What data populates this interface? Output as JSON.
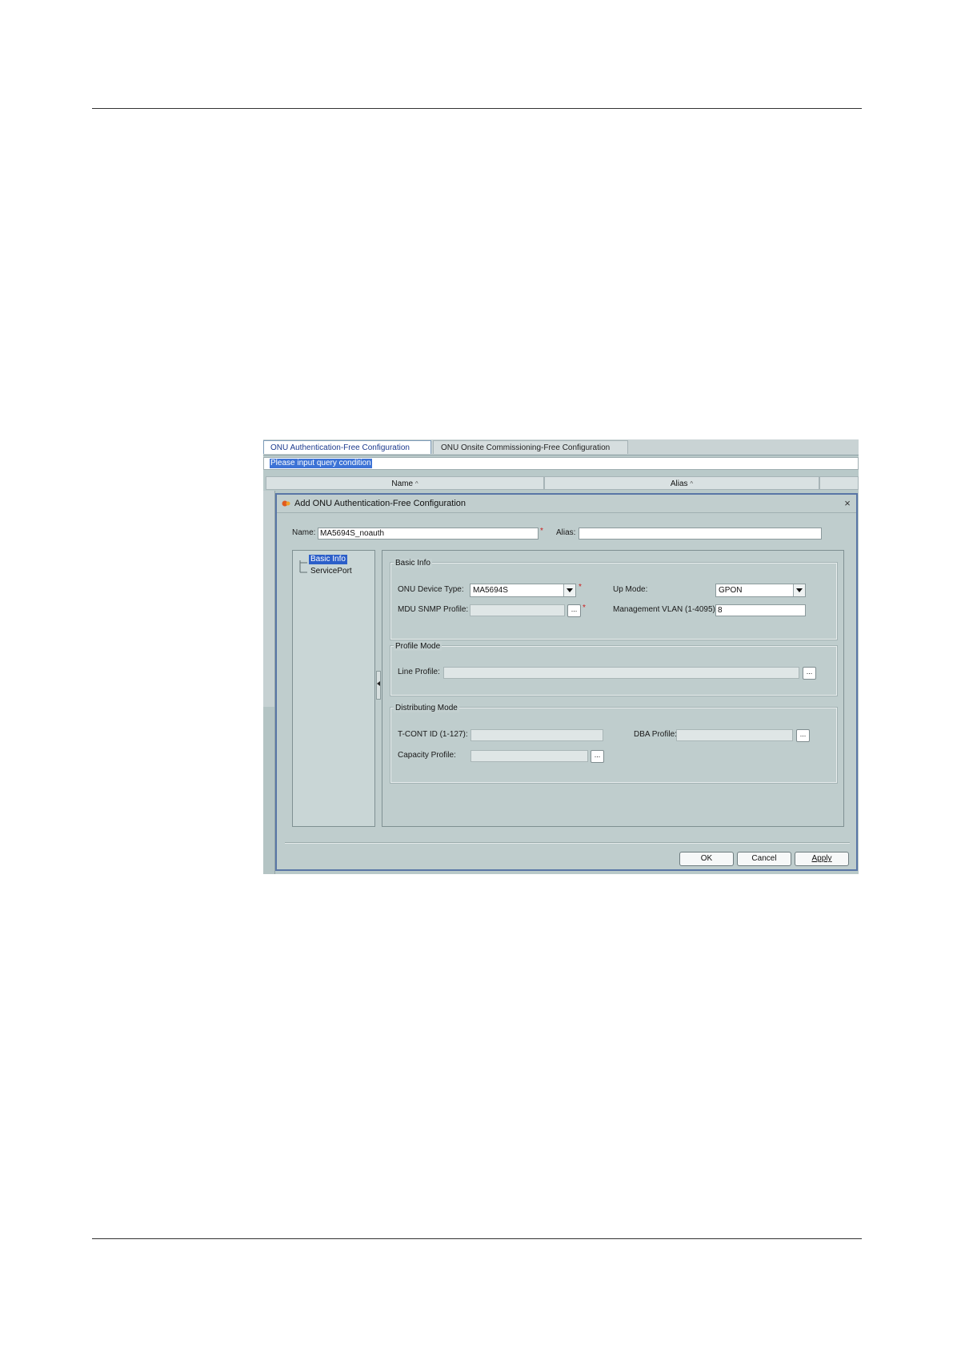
{
  "tabs": [
    {
      "label": "ONU Authentication-Free Configuration"
    },
    {
      "label": "ONU Onsite Commissioning-Free Configuration"
    }
  ],
  "query": {
    "placeholder": "Please input query condition"
  },
  "table": {
    "columns": [
      "Name",
      "Alias"
    ],
    "sort_glyph": "^"
  },
  "dialog": {
    "title": "Add ONU Authentication-Free Configuration",
    "close_glyph": "×",
    "name_label": "Name:",
    "name_value": "MA5694S_noauth",
    "alias_label": "Alias:",
    "alias_value": "",
    "required_mark": "*",
    "tree": [
      "Basic Info",
      "ServicePort"
    ],
    "basic_info": {
      "title": "Basic Info",
      "onu_device_type_label": "ONU Device Type:",
      "onu_device_type_value": "MA5694S",
      "up_mode_label": "Up Mode:",
      "up_mode_value": "GPON",
      "mdu_snmp_profile_label": "MDU SNMP Profile:",
      "mdu_snmp_profile_value": "",
      "mgmt_vlan_label": "Management VLAN (1-4095):",
      "mgmt_vlan_value": "8"
    },
    "profile_mode": {
      "title": "Profile Mode",
      "line_profile_label": "Line Profile:",
      "line_profile_value": ""
    },
    "distributing_mode": {
      "title": "Distributing Mode",
      "tcont_label": "T-CONT ID (1-127):",
      "tcont_value": "",
      "dba_profile_label": "DBA Profile:",
      "dba_profile_value": "",
      "capacity_profile_label": "Capacity Profile:",
      "capacity_profile_value": ""
    },
    "browse_glyph": "...",
    "buttons": {
      "ok": "OK",
      "cancel": "Cancel",
      "apply": "Apply"
    }
  }
}
